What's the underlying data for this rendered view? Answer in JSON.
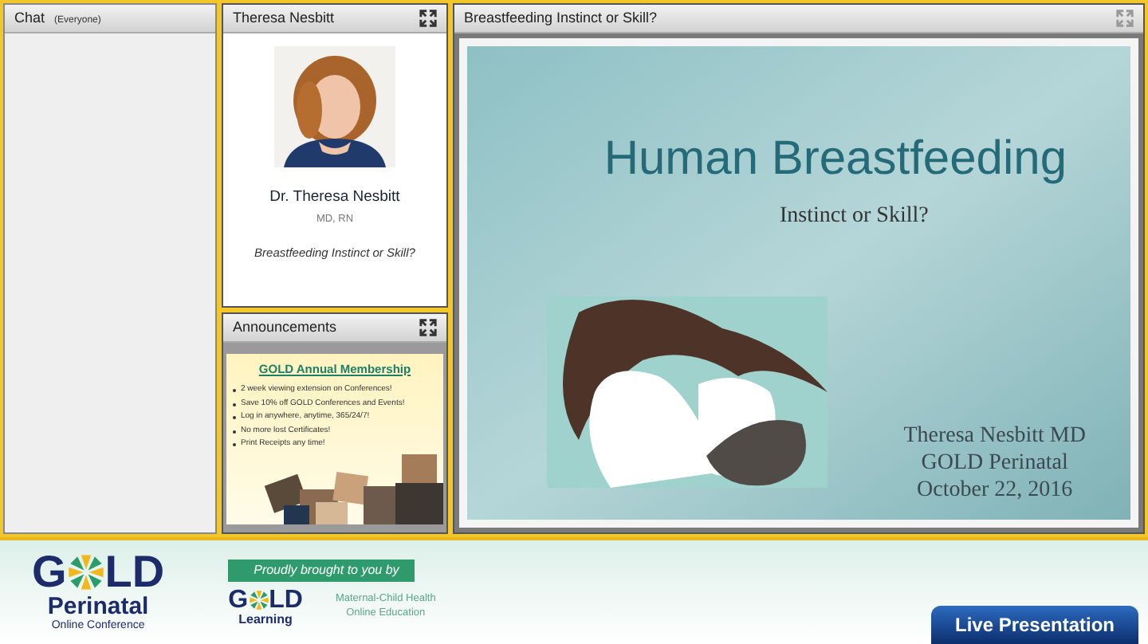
{
  "chat": {
    "title": "Chat",
    "audience": "(Everyone)"
  },
  "presenter": {
    "title": "Theresa Nesbitt",
    "name": "Dr. Theresa Nesbitt",
    "credentials": "MD, RN",
    "topic": "Breastfeeding Instinct or Skill?"
  },
  "announcements": {
    "title": "Announcements",
    "heading": "GOLD Annual Membership",
    "bullets": [
      "2 week viewing extension on Conferences!",
      "Save 10% off GOLD Conferences and Events!",
      "Log in anywhere, anytime, 365/24/7!",
      "No more lost Certificates!",
      "Print Receipts any time!"
    ]
  },
  "slide_pod": {
    "title": "Breastfeeding Instinct or Skill?",
    "slide": {
      "title": "Human Breastfeeding",
      "subtitle": "Instinct or Skill?",
      "footer_lines": [
        "Theresa Nesbitt MD",
        "GOLD Perinatal",
        "October 22, 2016"
      ]
    }
  },
  "footer": {
    "logo": {
      "start": "G",
      "end": "LD",
      "line1": "Perinatal",
      "line2": "Online Conference"
    },
    "sponsor_banner": "Proudly brought to you by",
    "sponsor_logo": {
      "start": "G",
      "end": "LD",
      "line": "Learning"
    },
    "sponsor_tagline": "Maternal-Child Health Online Education",
    "live_button": "Live Presentation"
  }
}
